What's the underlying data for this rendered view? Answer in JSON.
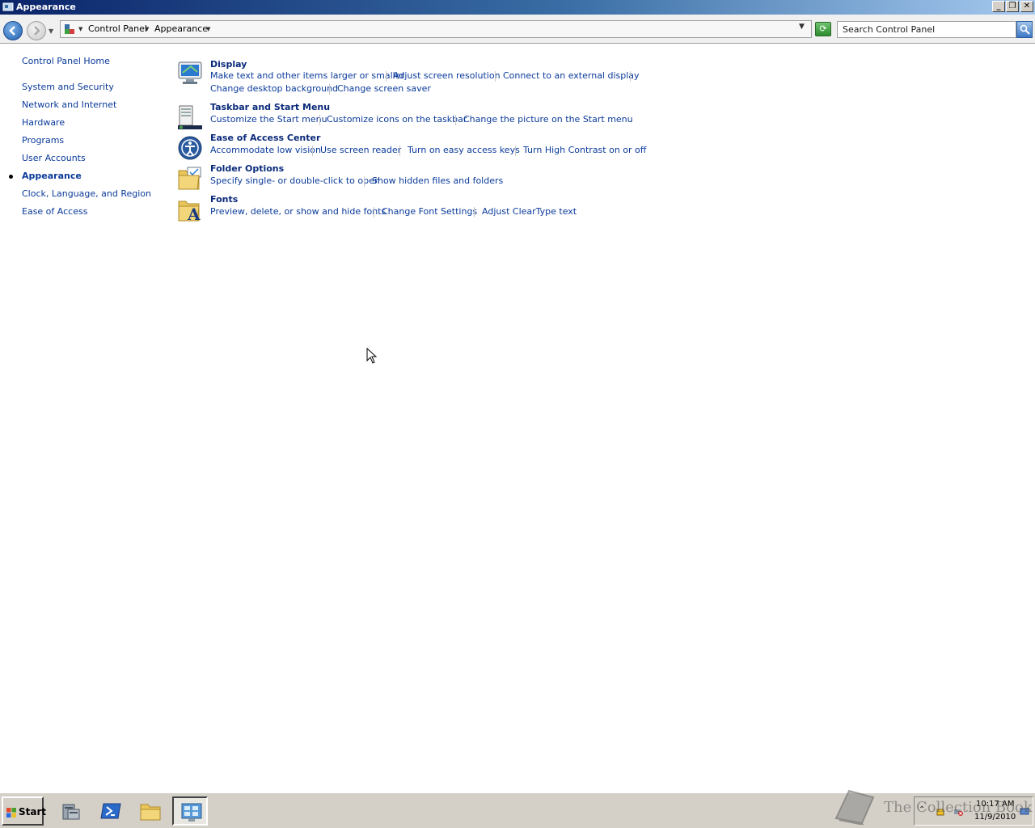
{
  "window": {
    "title": "Appearance"
  },
  "address_bar": {
    "breadcrumbs": [
      {
        "label": "Control Panel"
      },
      {
        "label": "Appearance"
      }
    ],
    "search_placeholder": "Search Control Panel"
  },
  "left_nav": {
    "home": "Control Panel Home",
    "items": [
      {
        "label": "System and Security"
      },
      {
        "label": "Network and Internet"
      },
      {
        "label": "Hardware"
      },
      {
        "label": "Programs"
      },
      {
        "label": "User Accounts"
      },
      {
        "label": "Appearance",
        "current": true
      },
      {
        "label": "Clock, Language, and Region"
      },
      {
        "label": "Ease of Access"
      }
    ]
  },
  "categories": [
    {
      "title": "Display",
      "icon": "display-icon",
      "tasks": [
        "Make text and other items larger or smaller",
        "Adjust screen resolution",
        "Connect to an external display",
        "Change desktop background",
        "Change screen saver"
      ]
    },
    {
      "title": "Taskbar and Start Menu",
      "icon": "taskbar-icon",
      "tasks": [
        "Customize the Start menu",
        "Customize icons on the taskbar",
        "Change the picture on the Start menu"
      ]
    },
    {
      "title": "Ease of Access Center",
      "icon": "ease-of-access-icon",
      "tasks": [
        "Accommodate low vision",
        "Use screen reader",
        "Turn on easy access keys",
        "Turn High Contrast on or off"
      ]
    },
    {
      "title": "Folder Options",
      "icon": "folder-options-icon",
      "tasks": [
        "Specify single- or double-click to open",
        "Show hidden files and folders"
      ]
    },
    {
      "title": "Fonts",
      "icon": "fonts-icon",
      "tasks": [
        "Preview, delete, or show and hide fonts",
        "Change Font Settings",
        "Adjust ClearType text"
      ]
    }
  ],
  "taskbar": {
    "start_label": "Start",
    "clock_time": "10:17 AM",
    "clock_date": "11/9/2010",
    "watermark": "The Collection Book"
  }
}
